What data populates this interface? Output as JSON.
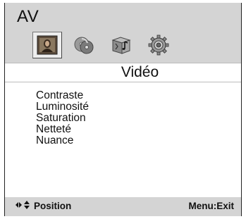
{
  "header": {
    "title": "AV",
    "tabs": [
      {
        "icon": "picture-icon",
        "selected": true
      },
      {
        "icon": "disc-icon",
        "selected": false
      },
      {
        "icon": "audio-icon",
        "selected": false
      },
      {
        "icon": "gear-icon",
        "selected": false
      }
    ]
  },
  "section": {
    "title": "Vidéo"
  },
  "menu": {
    "items": [
      {
        "label": "Contraste"
      },
      {
        "label": "Luminosité"
      },
      {
        "label": "Saturation"
      },
      {
        "label": "Netteté"
      },
      {
        "label": "Nuance"
      }
    ]
  },
  "footer": {
    "nav_glyph": "◆◆",
    "position_label": "Position",
    "exit_label": "Menu:Exit"
  },
  "colors": {
    "bar_background": "#d4d4d4",
    "text": "#111111"
  }
}
